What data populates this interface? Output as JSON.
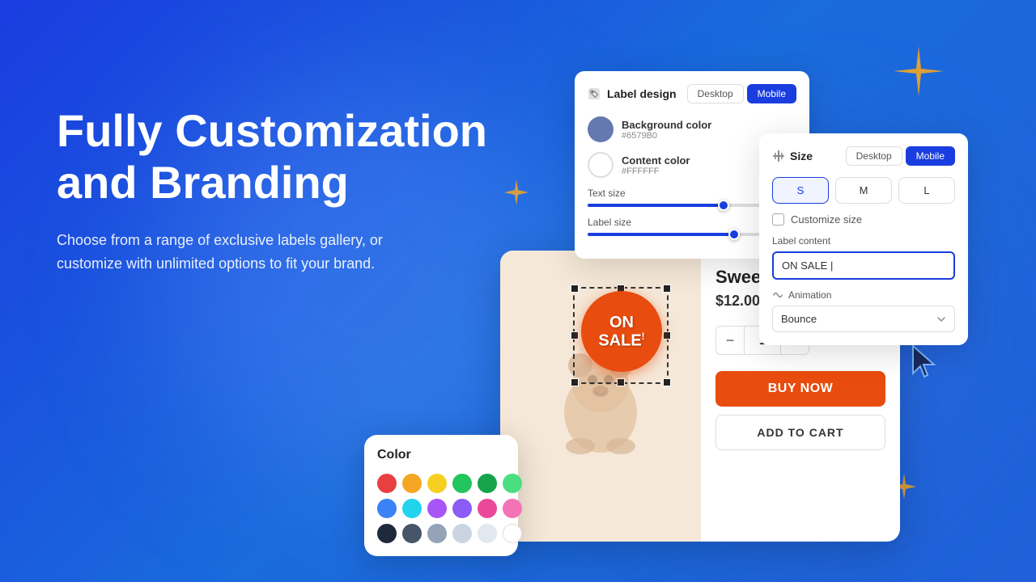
{
  "background": {
    "color_start": "#1a3de0",
    "color_end": "#2060d8"
  },
  "hero": {
    "title": "Fully Customization and Branding",
    "subtitle": "Choose from a range of exclusive labels gallery, or customize with unlimited options to fit your brand."
  },
  "label_design_panel": {
    "title": "Label design",
    "tab_desktop": "Desktop",
    "tab_mobile": "Mobile",
    "active_tab": "Mobile",
    "bg_color_label": "Background color",
    "bg_color_hex": "#6579B0",
    "content_color_label": "Content color",
    "content_color_hex": "#FFFFFF",
    "text_size_label": "Text size",
    "label_size_label": "Label size",
    "text_size_value": 65,
    "label_size_value": 70
  },
  "size_panel": {
    "title": "Size",
    "tab_desktop": "Desktop",
    "tab_mobile": "Mobile",
    "active_tab": "Mobile",
    "sizes": [
      "S",
      "M",
      "L"
    ],
    "active_size": "S",
    "customize_label": "Customize size",
    "label_content_title": "Label content",
    "label_content_value": "ON SALE |",
    "animation_label": "Animation",
    "animation_value": "Bounce"
  },
  "product": {
    "name": "Swee Pal Do",
    "price": "$12.00",
    "quantity": 1,
    "badge_line1": "ON",
    "badge_line2": "SALE",
    "badge_exclaim": "!",
    "buy_now_label": "BUY NOW",
    "add_to_cart_label": "ADD TO CART"
  },
  "color_picker": {
    "title": "Color",
    "colors": [
      "#e84040",
      "#f5a623",
      "#f5d020",
      "#22c55e",
      "#16a34a",
      "#4ade80",
      "#3b82f6",
      "#22d3ee",
      "#a855f7",
      "#8b5cf6",
      "#ec4899",
      "#f472b6",
      "#1e293b",
      "#475569",
      "#94a3b8",
      "#cbd5e1",
      "#e2e8f0",
      "#ffffff"
    ]
  }
}
